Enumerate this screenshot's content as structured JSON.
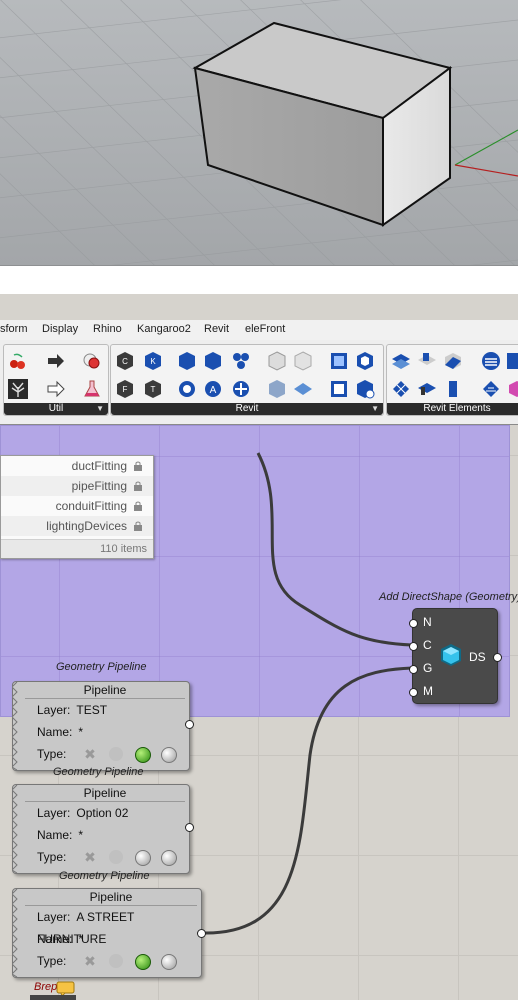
{
  "menu": {
    "items": [
      "sform",
      "Display",
      "Rhino",
      "Kangaroo2",
      "Revit",
      "eleFront"
    ]
  },
  "toolbar": {
    "panels": [
      "Util",
      "Revit",
      "Revit Elements"
    ],
    "colors": {
      "caption_bg": "#2b2b2b",
      "revit_blue": "#1a4fb0"
    }
  },
  "canvas": {
    "group_color": "#b3a6e6",
    "dropdown": {
      "items": [
        "ductFitting",
        "pipeFitting",
        "conduitFitting",
        "lightingDevices"
      ],
      "count": "110 items"
    },
    "ds_component": {
      "title": "Add DirectShape (Geometry)",
      "inputs": [
        "N",
        "C",
        "G",
        "M"
      ],
      "output": "DS",
      "icon": "directshape-icon"
    },
    "pipelines": [
      {
        "group_label": "Geometry Pipeline",
        "title": "Pipeline",
        "layer_label": "Layer:",
        "layer": "TEST",
        "name_label": "Name:",
        "name": "*",
        "type_label": "Type:"
      },
      {
        "group_label": "Geometry Pipeline",
        "title": "Pipeline",
        "layer_label": "Layer:",
        "layer": "Option 02",
        "name_label": "Name:",
        "name": "*",
        "type_label": "Type:"
      },
      {
        "group_label": "Geometry Pipeline",
        "title": "Pipeline",
        "layer_label": "Layer:",
        "layer": "A STREET FURNITURE",
        "name_label": "Name:",
        "name": "*",
        "type_label": "Type:"
      }
    ],
    "brep_label": "Brep"
  }
}
